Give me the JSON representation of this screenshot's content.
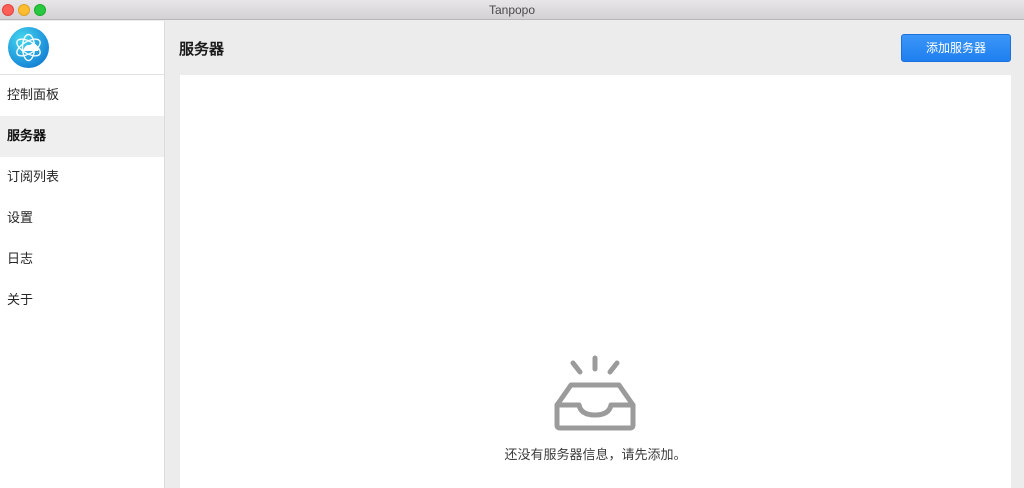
{
  "window": {
    "title": "Tanpopo"
  },
  "sidebar": {
    "logo_icon": "tanpopo-logo-icon",
    "items": [
      {
        "label": "控制面板",
        "active": false
      },
      {
        "label": "服务器",
        "active": true
      },
      {
        "label": "订阅列表",
        "active": false
      },
      {
        "label": "设置",
        "active": false
      },
      {
        "label": "日志",
        "active": false
      },
      {
        "label": "关于",
        "active": false
      }
    ]
  },
  "header": {
    "title": "服务器",
    "add_button_label": "添加服务器"
  },
  "main": {
    "empty_icon": "empty-inbox-icon",
    "empty_message": "还没有服务器信息，请先添加。"
  },
  "colors": {
    "accent": "#1f7ff0",
    "sidebar_active_bg": "#efefef",
    "window_bg": "#ececec"
  }
}
